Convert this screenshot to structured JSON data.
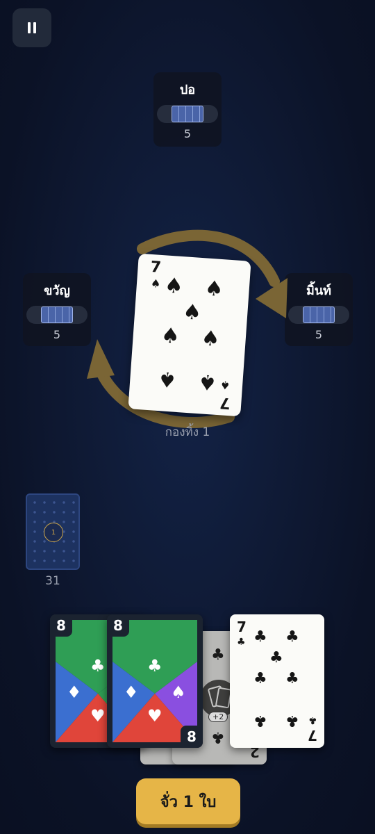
{
  "controls": {
    "pause_icon": "pause-icon"
  },
  "players": {
    "top": {
      "name": "ปอ",
      "count": "5"
    },
    "left": {
      "name": "ขวัญ",
      "count": "5"
    },
    "right": {
      "name": "มิ้นท์",
      "count": "5"
    }
  },
  "direction": {
    "icon": "clockwise-arrows-icon",
    "color": "#7a6535"
  },
  "discard": {
    "top_card": {
      "rank": "7",
      "suit": "♠",
      "suit_name": "spades"
    },
    "label": "กองทิ้ง 1"
  },
  "draw_pile": {
    "badge": "1",
    "count": "31"
  },
  "hand": [
    {
      "type": "wild",
      "rank": "8",
      "suits": [
        "♣",
        "♦",
        "♥"
      ]
    },
    {
      "type": "wild",
      "rank": "8",
      "suits": [
        "♣",
        "♦",
        "♠",
        "♥"
      ]
    },
    {
      "type": "special",
      "suit": "♣",
      "badge": "+2",
      "rank": "2"
    },
    {
      "type": "normal",
      "rank": "7",
      "suit": "♣",
      "suit_name": "clubs"
    }
  ],
  "actions": {
    "draw_label": "จั่ว 1 ใบ"
  },
  "colors": {
    "background": "#0f1a35",
    "button": "#e6b547",
    "wild_green": "#2f9e55",
    "wild_blue": "#3b6fd0",
    "wild_red": "#e0453a",
    "wild_purple": "#8a4fe0"
  }
}
